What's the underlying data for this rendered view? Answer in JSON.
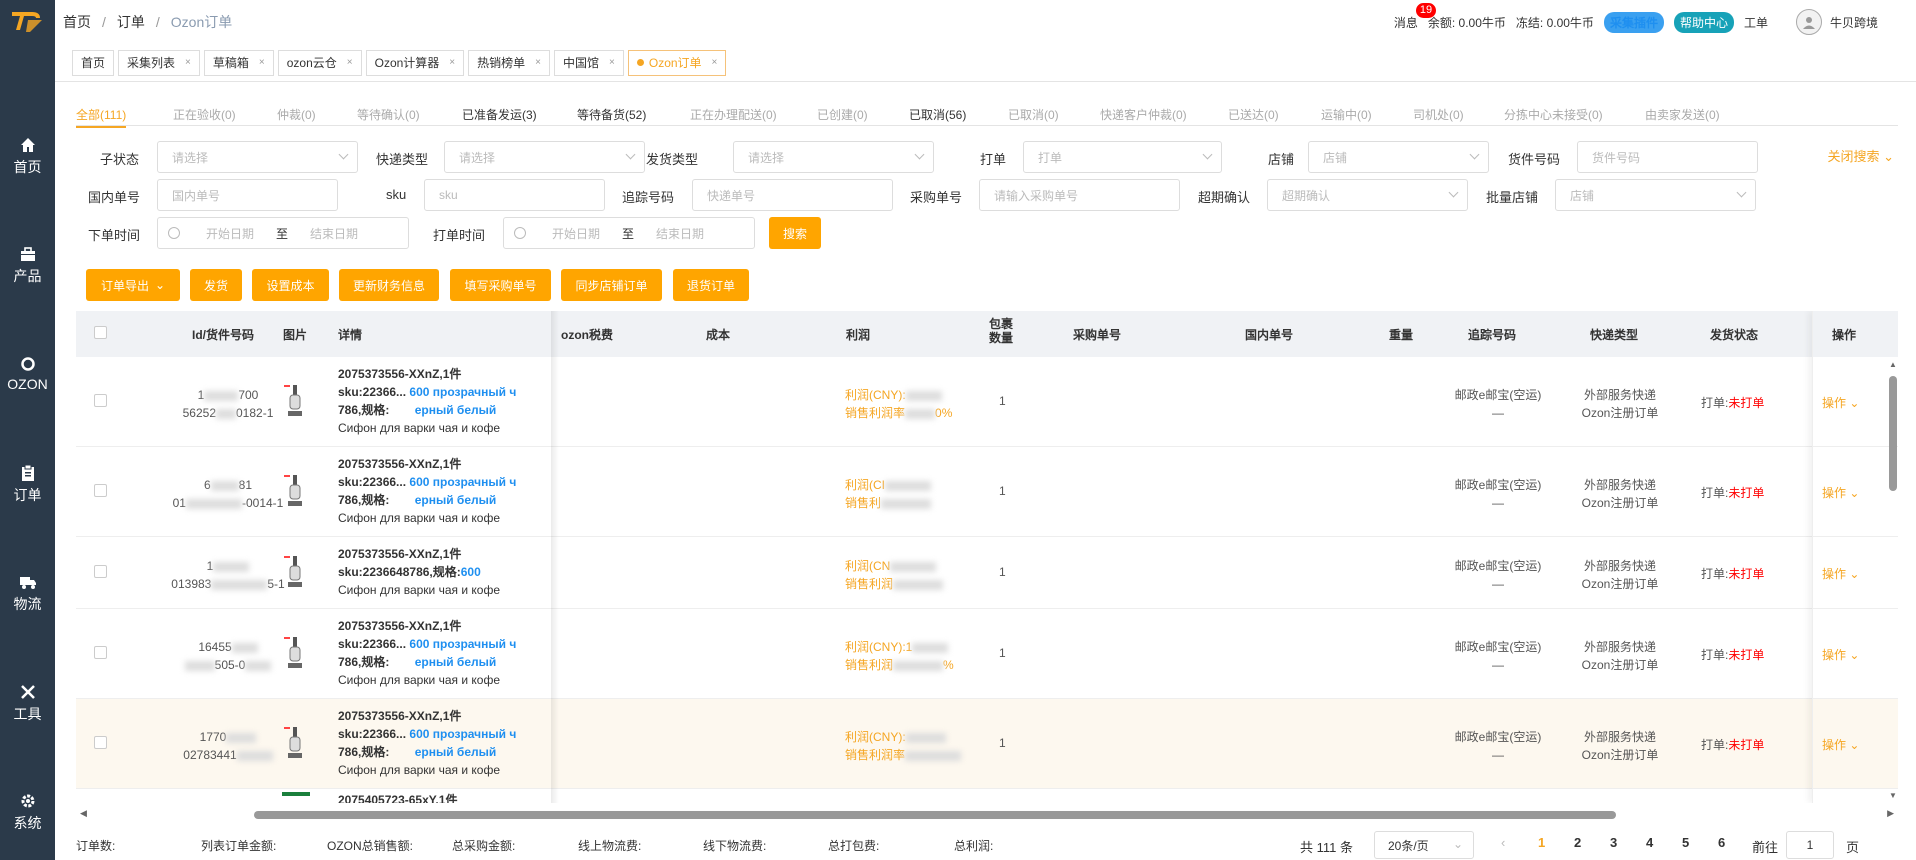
{
  "sidebar": {
    "items": [
      {
        "label": "首页",
        "icon": "home-icon"
      },
      {
        "label": "产品",
        "icon": "briefcase-icon"
      },
      {
        "label": "OZON",
        "icon": "ozon-icon"
      },
      {
        "label": "订单",
        "icon": "clipboard-icon"
      },
      {
        "label": "物流",
        "icon": "truck-icon"
      },
      {
        "label": "工具",
        "icon": "tools-icon"
      },
      {
        "label": "系统",
        "icon": "gear-icon"
      }
    ]
  },
  "breadcrumb": {
    "items": [
      "首页",
      "订单",
      "Ozon订单"
    ]
  },
  "topright": {
    "messages_label": "消息",
    "messages_count": "19",
    "balance": "余额: 0.00牛币",
    "frozen": "冻结: 0.00牛币",
    "plugin_btn": "采集插件",
    "help_btn": "帮助中心",
    "ticket": "工单",
    "user": "牛贝跨境"
  },
  "tabs": [
    "首页",
    "采集列表",
    "草稿箱",
    "ozon云仓",
    "Ozon计算器",
    "热销榜单",
    "中国馆",
    "Ozon订单"
  ],
  "status_tabs": [
    "全部(111)",
    "正在验收(0)",
    "仲裁(0)",
    "等待确认(0)",
    "已准备发运(3)",
    "等待备货(52)",
    "正在办理配送(0)",
    "已创建(0)",
    "已取消(56)",
    "已取消(0)",
    "快递客户仲裁(0)",
    "已送达(0)",
    "运输中(0)",
    "司机处(0)",
    "分拣中心未接受(0)",
    "由卖家发送(0)"
  ],
  "filters": {
    "sub_status": {
      "label": "子状态",
      "placeholder": "请选择"
    },
    "express_type": {
      "label": "快递类型",
      "placeholder": "请选择"
    },
    "ship_type": {
      "label": "发货类型",
      "placeholder": "请选择"
    },
    "print": {
      "label": "打单",
      "placeholder": "打单"
    },
    "store": {
      "label": "店铺",
      "placeholder": "店铺"
    },
    "item_no": {
      "label": "货件号码",
      "placeholder": "货件号码"
    },
    "domestic_no": {
      "label": "国内单号",
      "placeholder": "国内单号"
    },
    "sku": {
      "label": "sku",
      "placeholder": "sku"
    },
    "tracking": {
      "label": "追踪号码",
      "placeholder": "快递单号"
    },
    "purchase_no": {
      "label": "采购单号",
      "placeholder": "请输入采购单号"
    },
    "overdue": {
      "label": "超期确认",
      "placeholder": "超期确认"
    },
    "batch_store": {
      "label": "批量店铺",
      "placeholder": "店铺"
    },
    "order_time": {
      "label": "下单时间",
      "start": "开始日期",
      "to": "至",
      "end": "结束日期"
    },
    "print_time": {
      "label": "打单时间",
      "start": "开始日期",
      "to": "至",
      "end": "结束日期"
    },
    "search_btn": "搜索",
    "close_search": "关闭搜索"
  },
  "actions": [
    "订单导出",
    "发货",
    "设置成本",
    "更新财务信息",
    "填写采购单号",
    "同步店铺订单",
    "退货订单"
  ],
  "table": {
    "headers": [
      "Id/货件号码",
      "图片",
      "详情",
      "ozon税费",
      "成本",
      "利润",
      "包裹数量",
      "采购单号",
      "国内单号",
      "重量",
      "追踪号码",
      "快递类型",
      "发货状态",
      "操作"
    ],
    "rows": [
      {
        "id1": "1",
        "id1b": "700",
        "id2": "56252",
        "id2b": "0182-1",
        "title": "2075373556-XXnZ,1件",
        "sku_a": "sku:22366...",
        "sku_b": "786,规格:",
        "spec_a": "600 прозрачный ч",
        "spec_b": "ерный белый",
        "name": "Сифон для варки чая и кофе",
        "profit1": "利润(CNY):",
        "profit2": "销售利润率",
        "profit2b": "0%",
        "pkg": "1",
        "track1": "邮政e邮宝(空运)",
        "track2": "—",
        "exp1": "外部服务快递",
        "exp2": "Ozon注册订单",
        "ship_label": "打单:",
        "ship_status": "未打单",
        "op": "操作"
      },
      {
        "id1": "6",
        "id1b": "81",
        "id2": "01",
        "id2b": "-0014-1",
        "title": "2075373556-XXnZ,1件",
        "sku_a": "sku:22366...",
        "sku_b": "786,规格:",
        "spec_a": "600 прозрачный ч",
        "spec_b": "ерный белый",
        "name": "Сифон для варки чая и кофе",
        "profit1": "利润(CI",
        "profit2": "销售利",
        "profit2b": "",
        "pkg": "1",
        "track1": "邮政e邮宝(空运)",
        "track2": "—",
        "exp1": "外部服务快递",
        "exp2": "Ozon注册订单",
        "ship_label": "打单:",
        "ship_status": "未打单",
        "op": "操作"
      },
      {
        "id1": "1",
        "id1b": "",
        "id2": "013983",
        "id2b": "5-1",
        "title": "2075373556-XXnZ,1件",
        "sku_a": "sku:2236648786,规格:",
        "sku_b": "",
        "spec_a": "600",
        "spec_b": "",
        "name": "Сифон для варки чая и кофе",
        "profit1": "利润(CN",
        "profit2": "销售利润",
        "profit2b": "",
        "pkg": "1",
        "track1": "邮政e邮宝(空运)",
        "track2": "—",
        "exp1": "外部服务快递",
        "exp2": "Ozon注册订单",
        "ship_label": "打单:",
        "ship_status": "未打单",
        "op": "操作"
      },
      {
        "id1": "16455",
        "id1b": "",
        "id2": "",
        "id2b": "505-0",
        "title": "2075373556-XXnZ,1件",
        "sku_a": "sku:22366...",
        "sku_b": "786,规格:",
        "spec_a": "600 прозрачный ч",
        "spec_b": "ерный белый",
        "name": "Сифон для варки чая и кофе",
        "profit1": "利润(CNY):1",
        "profit2": "销售利润",
        "profit2b": "%",
        "pkg": "1",
        "track1": "邮政e邮宝(空运)",
        "track2": "—",
        "exp1": "外部服务快递",
        "exp2": "Ozon注册订单",
        "ship_label": "打单:",
        "ship_status": "未打单",
        "op": "操作"
      },
      {
        "id1": "1770",
        "id1b": "",
        "id2": "02783441",
        "id2b": "",
        "title": "2075373556-XXnZ,1件",
        "sku_a": "sku:22366...",
        "sku_b": "786,规格:",
        "spec_a": "600 прозрачный ч",
        "spec_b": "ерный белый",
        "name": "Сифон для варки чая и кофе",
        "profit1": "利润(CNY):",
        "profit2": "销售利润率",
        "profit2b": "",
        "pkg": "1",
        "track1": "邮政e邮宝(空运)",
        "track2": "—",
        "exp1": "外部服务快递",
        "exp2": "Ozon注册订单",
        "ship_label": "打单:",
        "ship_status": "未打单",
        "op": "操作"
      }
    ],
    "partial_row_title": "2075405723-65xY,1件"
  },
  "footer": {
    "stats": [
      "订单数:",
      "列表订单金额:",
      "OZON总销售额:",
      "总采购金额:",
      "线上物流费:",
      "线下物流费:",
      "总打包费:",
      "总利润:"
    ],
    "total": "共 111 条",
    "page_size": "20条/页",
    "pages": [
      "1",
      "2",
      "3",
      "4",
      "5",
      "6"
    ],
    "goto_label": "前往",
    "goto_value": "1",
    "page_unit": "页",
    "current_page": "1"
  },
  "colors": {
    "accent": "#f5a623",
    "button": "#ffa500",
    "sidebar": "#2b3a4a",
    "link": "#1e8ff0",
    "danger": "#ff0000"
  }
}
